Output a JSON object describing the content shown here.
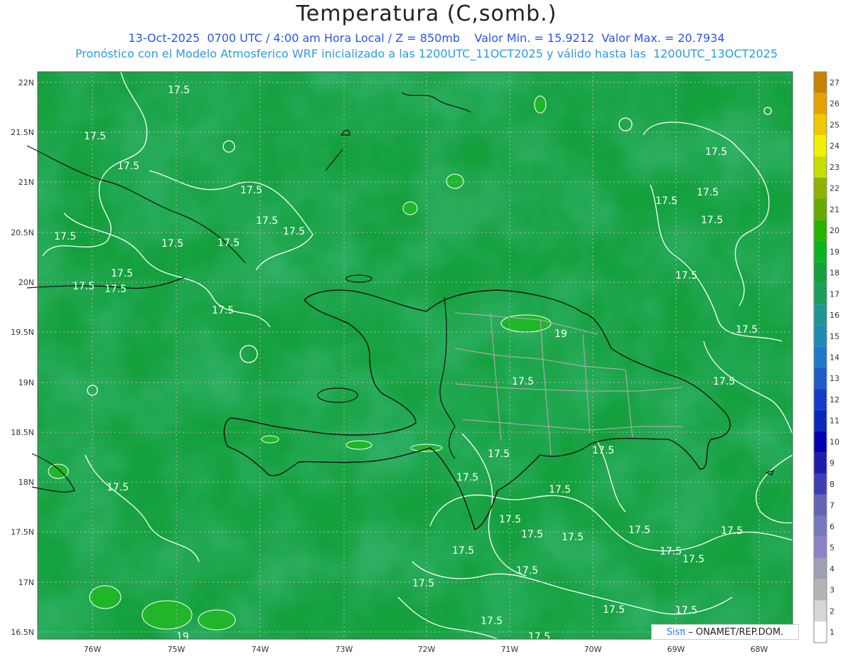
{
  "header": {
    "title": "Temperatura (C,somb.)",
    "line1": "13-Oct-2025  0700 UTC / 4:00 am Hora Local / Z = 850mb    Valor Min. = 15.9212  Valor Max. = 20.7934",
    "line2": "Pronóstico con el Modelo Atmosferico WRF inicializado a las 1200UTC_11OCT2025 y válido hasta las  1200UTC_13OCT2025"
  },
  "axes": {
    "lat_labels": [
      "22N",
      "21.5N",
      "21N",
      "20.5N",
      "20N",
      "19.5N",
      "19N",
      "18.5N",
      "18N",
      "17.5N",
      "17N",
      "16.5N"
    ],
    "lon_labels": [
      "76W",
      "75W",
      "74W",
      "73W",
      "72W",
      "71W",
      "70W",
      "69W",
      "68W"
    ]
  },
  "colorbar": {
    "levels": [
      "1",
      "2",
      "3",
      "4",
      "5",
      "6",
      "7",
      "8",
      "9",
      "10",
      "11",
      "12",
      "13",
      "14",
      "15",
      "16",
      "17",
      "18",
      "19",
      "20",
      "21",
      "22",
      "23",
      "24",
      "25",
      "26",
      "27"
    ],
    "colors": [
      "#ffffff",
      "#d7d7d7",
      "#b4b4b4",
      "#a0a0b4",
      "#8c82c8",
      "#7878be",
      "#6464b4",
      "#3c3cb4",
      "#1e1eaa",
      "#0000b4",
      "#0a28be",
      "#143cc8",
      "#1e5ac8",
      "#1e78c8",
      "#1e8cb4",
      "#1e9696",
      "#1aa05a",
      "#14a03c",
      "#0ab41e",
      "#28b400",
      "#64aa00",
      "#8cb400",
      "#c8dc00",
      "#f0f000",
      "#f0c800",
      "#e6a000",
      "#c88200"
    ]
  },
  "contour_labels": [
    "17.5",
    "19"
  ],
  "credit": {
    "prefix": "Sisπ",
    "text": "– ONAMET/REP.DOM."
  }
}
